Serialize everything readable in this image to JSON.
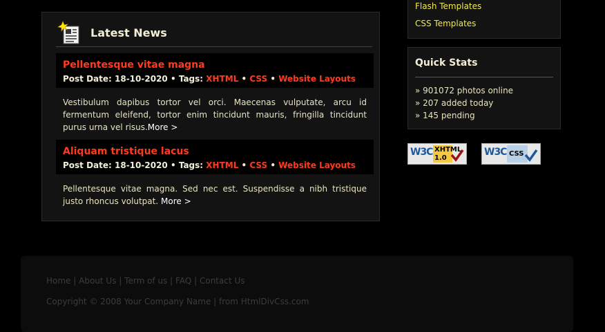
{
  "news": {
    "title": "Latest News",
    "items": [
      {
        "title": "Pellentesque vitae magna",
        "post_date_label": "Post Date: 18-10-2020",
        "tags_label": "Tags:",
        "tags": [
          "XHTML",
          "CSS",
          "Website Layouts"
        ],
        "body": "Vestibulum dapibus tortor vel orci. Maecenas vulputate, arcu id fermentum eleifend, tortor enim tincidunt mauris, fringilla tincidunt purus urna vel risus.",
        "more": "More >"
      },
      {
        "title": "Aliquam tristique lacus",
        "post_date_label": "Post Date: 18-10-2020",
        "tags_label": "Tags:",
        "tags": [
          "XHTML",
          "CSS",
          "Website Layouts"
        ],
        "body": "Pellentesque vitae magna. Sed nec est. Suspendisse a nibh tristique justo rhoncus volutpat.",
        "more": "More >"
      }
    ]
  },
  "sidebar": {
    "links": [
      "Flash Templates",
      "CSS Templates"
    ],
    "stats": {
      "title": "Quick Stats",
      "lines": [
        "» 901072 photos online",
        "» 207 added today",
        "» 145 pending"
      ]
    },
    "badges": {
      "w3c": "W3C",
      "xhtml_label": "XHTML",
      "xhtml_version": "1.0",
      "css_label": "CSS"
    }
  },
  "footer": {
    "nav": [
      "Home",
      "About Us",
      "Term of us",
      "FAQ",
      "Contact Us"
    ],
    "separator": "|",
    "copyright": "Copyright © 2008 Your Company Name | from HtmlDivCss.com"
  },
  "colors": {
    "accent": "#ff3a1e",
    "link_yellow": "#f0ea50",
    "panel": "#131313"
  }
}
